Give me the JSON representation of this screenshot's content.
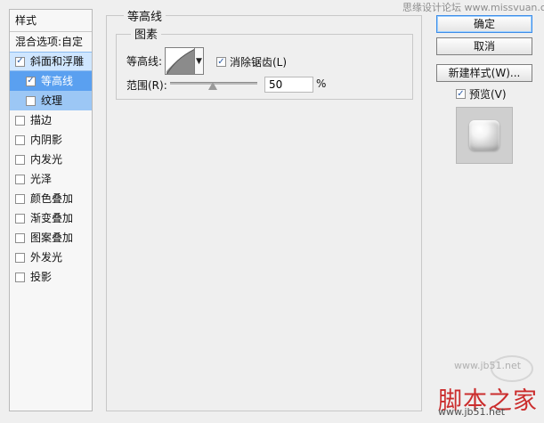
{
  "left_panel": {
    "title": "样式",
    "items": [
      {
        "label": "混合选项:自定",
        "checked": false,
        "selected": false
      },
      {
        "label": "斜面和浮雕",
        "checked": true,
        "selected": true
      },
      {
        "label": "等高线",
        "checked": true,
        "selected": true,
        "sub": true,
        "active": true
      },
      {
        "label": "纹理",
        "checked": false,
        "selected": false,
        "sub": true,
        "active": false
      },
      {
        "label": "描边",
        "checked": false,
        "selected": false
      },
      {
        "label": "内阴影",
        "checked": false,
        "selected": false
      },
      {
        "label": "内发光",
        "checked": false,
        "selected": false
      },
      {
        "label": "光泽",
        "checked": false,
        "selected": false
      },
      {
        "label": "颜色叠加",
        "checked": false,
        "selected": false
      },
      {
        "label": "渐变叠加",
        "checked": false,
        "selected": false
      },
      {
        "label": "图案叠加",
        "checked": false,
        "selected": false
      },
      {
        "label": "外发光",
        "checked": false,
        "selected": false
      },
      {
        "label": "投影",
        "checked": false,
        "selected": false
      }
    ]
  },
  "main": {
    "group_title": "等高线",
    "inner_title": "图素",
    "contour_label": "等高线:",
    "anti_alias_label": "消除锯齿(L)",
    "anti_alias_checked": true,
    "range_label": "范围(R):",
    "range_value": "50",
    "range_unit": "%"
  },
  "right_panel": {
    "ok_label": "确定",
    "cancel_label": "取消",
    "new_style_label": "新建样式(W)...",
    "preview_label": "预览(V)",
    "preview_checked": true
  },
  "watermarks": {
    "top": "思缘设计论坛 www.missvuan.com",
    "bottom_main": "脚本之家",
    "bottom_url": "www.jb51.net",
    "bottom_left_url": "www.jb51.net"
  }
}
